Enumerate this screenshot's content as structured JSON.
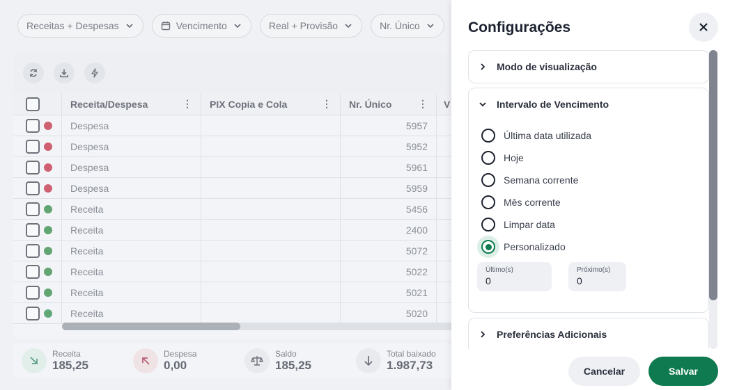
{
  "filters": [
    {
      "label": "Receitas + Despesas",
      "icon": null
    },
    {
      "label": "Vencimento",
      "icon": "calendar-icon"
    },
    {
      "label": "Real + Provisão",
      "icon": null
    },
    {
      "label": "Nr. Único",
      "icon": null
    }
  ],
  "toolbar": {
    "icons": [
      "refresh-icon",
      "download-icon",
      "lightning-icon"
    ]
  },
  "table": {
    "columns": [
      "Receita/Despesa",
      "PIX Copia e Cola",
      "Nr. Único",
      "V"
    ],
    "rows": [
      {
        "type": "Despesa",
        "pix": "",
        "nr": "5957",
        "status_color": "#c0152f"
      },
      {
        "type": "Despesa",
        "pix": "",
        "nr": "5952",
        "status_color": "#c0152f"
      },
      {
        "type": "Despesa",
        "pix": "",
        "nr": "5961",
        "status_color": "#c0152f"
      },
      {
        "type": "Despesa",
        "pix": "",
        "nr": "5959",
        "status_color": "#c0152f"
      },
      {
        "type": "Receita",
        "pix": "",
        "nr": "5456",
        "status_color": "#1a7f2e"
      },
      {
        "type": "Receita",
        "pix": "",
        "nr": "2400",
        "status_color": "#1a7f2e"
      },
      {
        "type": "Receita",
        "pix": "",
        "nr": "5072",
        "status_color": "#1a7f2e"
      },
      {
        "type": "Receita",
        "pix": "",
        "nr": "5022",
        "status_color": "#1a7f2e"
      },
      {
        "type": "Receita",
        "pix": "",
        "nr": "5021",
        "status_color": "#1a7f2e"
      },
      {
        "type": "Receita",
        "pix": "",
        "nr": "5020",
        "status_color": "#1a7f2e"
      }
    ]
  },
  "totals": [
    {
      "label": "Receita",
      "value": "185,25",
      "icon": "arrow-down-right-icon",
      "bg": "#dcefe6",
      "fg": "#0f7a4f"
    },
    {
      "label": "Despesa",
      "value": "0,00",
      "icon": "arrow-up-left-icon",
      "bg": "#f3dde0",
      "fg": "#a01530"
    },
    {
      "label": "Saldo",
      "value": "185,25",
      "icon": "scale-icon",
      "bg": "#e6e8ec",
      "fg": "#2a2f3b"
    },
    {
      "label": "Total baixado",
      "value": "1.987,73",
      "icon": "arrow-down-icon",
      "bg": "#e6e8ec",
      "fg": "#2a2f3b"
    }
  ],
  "panel": {
    "title": "Configurações",
    "sections": {
      "view_mode": "Modo de visualização",
      "due_interval": "Intervalo de Vencimento",
      "extra_prefs": "Preferências Adicionais"
    },
    "options": [
      {
        "label": "Última data utilizada",
        "selected": false
      },
      {
        "label": "Hoje",
        "selected": false
      },
      {
        "label": "Semana corrente",
        "selected": false
      },
      {
        "label": "Mês corrente",
        "selected": false
      },
      {
        "label": "Limpar data",
        "selected": false
      },
      {
        "label": "Personalizado",
        "selected": true
      }
    ],
    "fields": {
      "last": {
        "label": "Último(s)",
        "value": "0"
      },
      "next": {
        "label": "Próximo(s)",
        "value": "0"
      }
    },
    "buttons": {
      "cancel": "Cancelar",
      "save": "Salvar"
    }
  },
  "colors": {
    "accent": "#0f7a4f",
    "despesa": "#c0152f",
    "receita": "#1a7f2e"
  }
}
